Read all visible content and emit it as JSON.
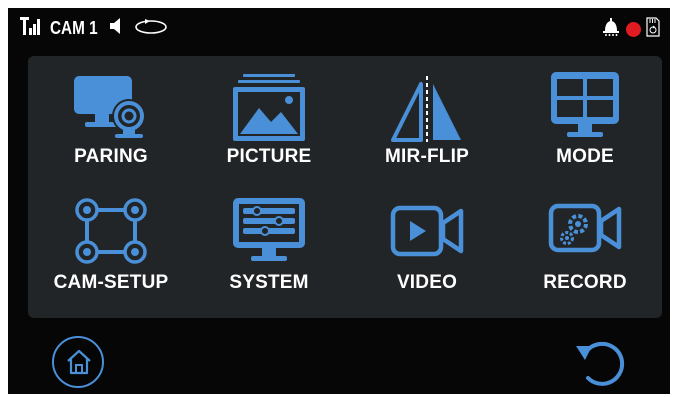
{
  "status_bar": {
    "camera_label": "CAM 1",
    "icons": [
      "signal-icon",
      "speaker-icon",
      "rotate-icon",
      "alarm-icon",
      "record-dot-icon",
      "sd-card-icon"
    ],
    "record_color": "#e11b22"
  },
  "menu": {
    "accent_color": "#4a90d9",
    "items": [
      {
        "label": "PARING",
        "icon": "monitor-camera-icon"
      },
      {
        "label": "PICTURE",
        "icon": "picture-icon"
      },
      {
        "label": "MIR-FLIP",
        "icon": "mirror-flip-icon"
      },
      {
        "label": "MODE",
        "icon": "quad-screen-icon"
      },
      {
        "label": "CAM-SETUP",
        "icon": "camera-network-icon"
      },
      {
        "label": "SYSTEM",
        "icon": "system-settings-icon"
      },
      {
        "label": "VIDEO",
        "icon": "video-icon"
      },
      {
        "label": "RECORD",
        "icon": "record-settings-icon"
      }
    ]
  },
  "bottom_bar": {
    "home_icon": "home-icon",
    "back_icon": "back-arrow-icon"
  }
}
